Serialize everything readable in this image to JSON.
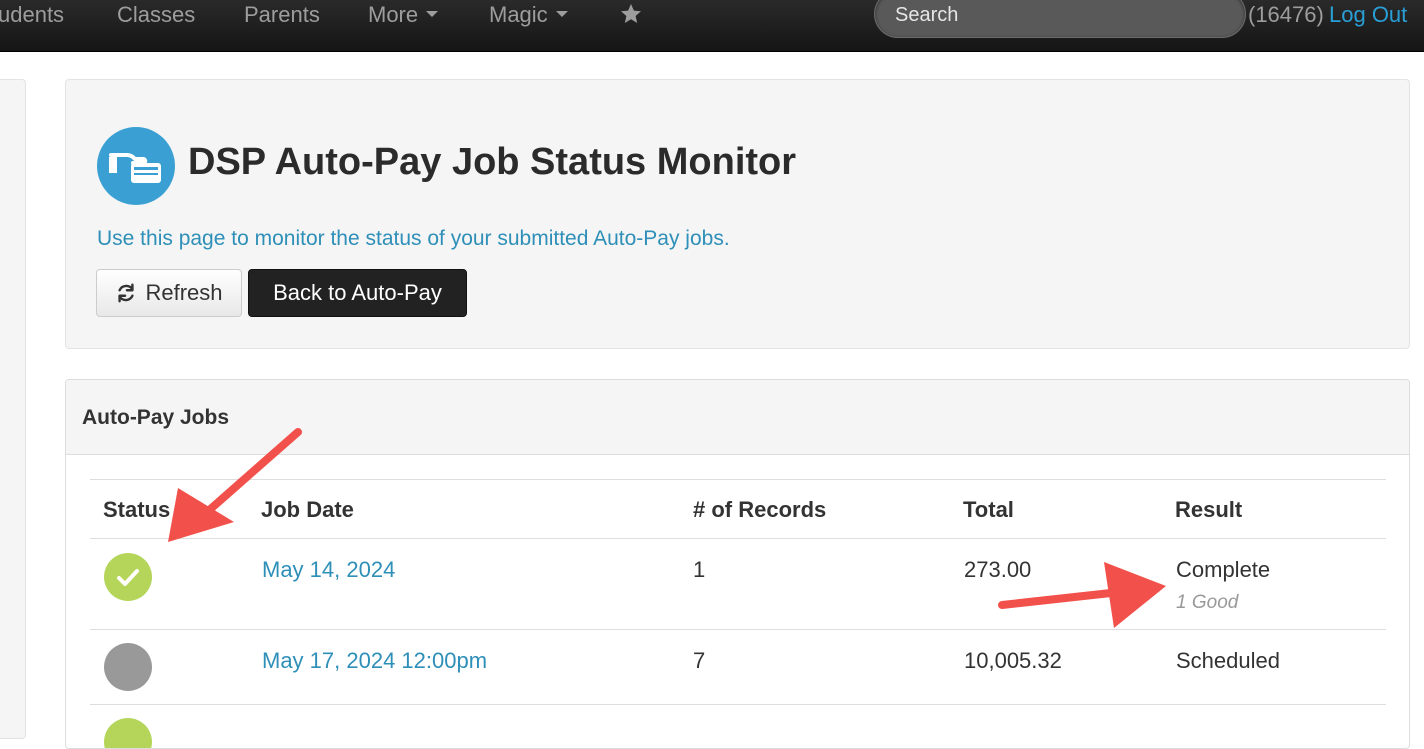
{
  "nav": {
    "items": [
      {
        "label": "udents"
      },
      {
        "label": "Classes"
      },
      {
        "label": "Parents"
      },
      {
        "label": "More"
      },
      {
        "label": "Magic"
      }
    ],
    "favorites_icon": "star-icon",
    "search_placeholder": "Search",
    "user_id": "(16476)",
    "logout_label": "Log Out"
  },
  "header": {
    "icon": "payment-card-hand-icon",
    "title": "DSP Auto-Pay Job Status Monitor",
    "subtitle": "Use this page to monitor the status of your submitted Auto-Pay jobs.",
    "refresh_label": "Refresh",
    "refresh_icon": "refresh-icon",
    "back_label": "Back to Auto-Pay"
  },
  "jobs": {
    "panel_title": "Auto-Pay Jobs",
    "columns": [
      "Status",
      "Job Date",
      "# of Records",
      "Total",
      "Result"
    ],
    "rows": [
      {
        "status": "complete",
        "status_color": "#b5d55a",
        "date": "May 14, 2024",
        "records": "1",
        "total": "273.00",
        "result": "Complete",
        "detail": "1 Good"
      },
      {
        "status": "scheduled",
        "status_color": "#999999",
        "date": "May 17, 2024 12:00pm",
        "records": "7",
        "total": "10,005.32",
        "result": "Scheduled",
        "detail": ""
      },
      {
        "status": "complete",
        "status_color": "#b5d55a",
        "date": "",
        "records": "",
        "total": "",
        "result": "",
        "detail": ""
      }
    ]
  },
  "colors": {
    "accent": "#2e8fb8",
    "annotation_arrow": "#f2504b",
    "complete_green": "#b5d55a",
    "scheduled_gray": "#999999"
  }
}
